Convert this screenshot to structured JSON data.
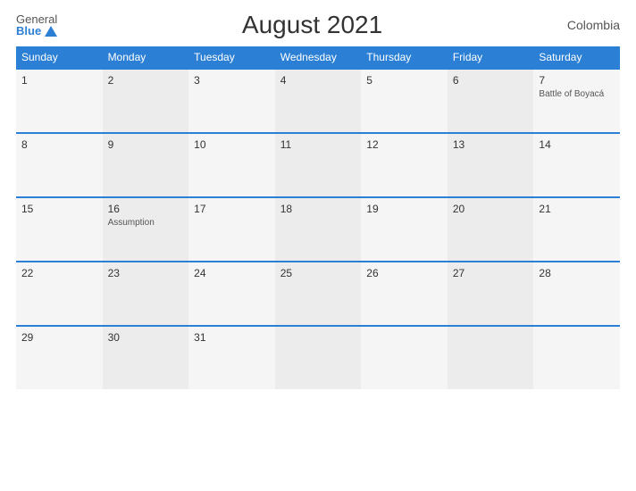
{
  "header": {
    "logo_general": "General",
    "logo_blue": "Blue",
    "title": "August 2021",
    "country": "Colombia"
  },
  "dayHeaders": [
    "Sunday",
    "Monday",
    "Tuesday",
    "Wednesday",
    "Thursday",
    "Friday",
    "Saturday"
  ],
  "weeks": [
    [
      {
        "date": "1",
        "event": ""
      },
      {
        "date": "2",
        "event": ""
      },
      {
        "date": "3",
        "event": ""
      },
      {
        "date": "4",
        "event": ""
      },
      {
        "date": "5",
        "event": ""
      },
      {
        "date": "6",
        "event": ""
      },
      {
        "date": "7",
        "event": "Battle of Boyacá"
      }
    ],
    [
      {
        "date": "8",
        "event": ""
      },
      {
        "date": "9",
        "event": ""
      },
      {
        "date": "10",
        "event": ""
      },
      {
        "date": "11",
        "event": ""
      },
      {
        "date": "12",
        "event": ""
      },
      {
        "date": "13",
        "event": ""
      },
      {
        "date": "14",
        "event": ""
      }
    ],
    [
      {
        "date": "15",
        "event": ""
      },
      {
        "date": "16",
        "event": "Assumption"
      },
      {
        "date": "17",
        "event": ""
      },
      {
        "date": "18",
        "event": ""
      },
      {
        "date": "19",
        "event": ""
      },
      {
        "date": "20",
        "event": ""
      },
      {
        "date": "21",
        "event": ""
      }
    ],
    [
      {
        "date": "22",
        "event": ""
      },
      {
        "date": "23",
        "event": ""
      },
      {
        "date": "24",
        "event": ""
      },
      {
        "date": "25",
        "event": ""
      },
      {
        "date": "26",
        "event": ""
      },
      {
        "date": "27",
        "event": ""
      },
      {
        "date": "28",
        "event": ""
      }
    ],
    [
      {
        "date": "29",
        "event": ""
      },
      {
        "date": "30",
        "event": ""
      },
      {
        "date": "31",
        "event": ""
      },
      {
        "date": "",
        "event": ""
      },
      {
        "date": "",
        "event": ""
      },
      {
        "date": "",
        "event": ""
      },
      {
        "date": "",
        "event": ""
      }
    ]
  ]
}
